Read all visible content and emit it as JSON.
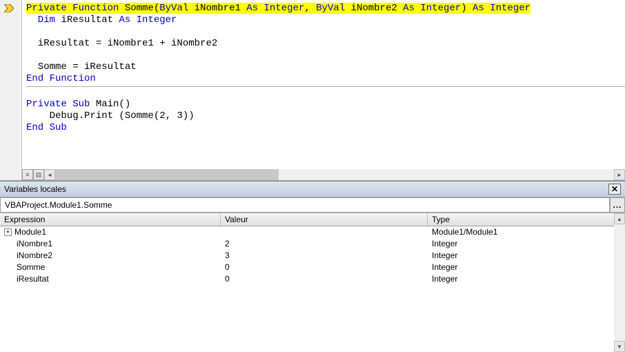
{
  "code": {
    "line1_highlighted": true,
    "l1a": "Private Function ",
    "l1b": "Somme(",
    "l1c": "ByVal ",
    "l1d": "iNombre1 ",
    "l1e": "As Integer",
    "l1f": ", ",
    "l1g": "ByVal ",
    "l1h": "iNombre2 ",
    "l1i": "As Integer",
    "l1j": ") ",
    "l1k": "As Integer",
    "l2a": "  Dim ",
    "l2b": "iResultat ",
    "l2c": "As Integer",
    "l4": "  iResultat = iNombre1 + iNombre2",
    "l6": "  Somme = iResultat",
    "l7": "End Function",
    "l9a": "Private Sub ",
    "l9b": "Main()",
    "l10": "    Debug.Print (Somme(2, 3))",
    "l11": "End Sub"
  },
  "locals": {
    "title": "Variables locales",
    "context": "VBAProject.Module1.Somme",
    "headers": {
      "expr": "Expression",
      "val": "Valeur",
      "type": "Type"
    },
    "rows": [
      {
        "expander": "+",
        "indent": 0,
        "expr": "Module1",
        "val": "",
        "type": "Module1/Module1"
      },
      {
        "expander": "",
        "indent": 1,
        "expr": "iNombre1",
        "val": "2",
        "type": "Integer"
      },
      {
        "expander": "",
        "indent": 1,
        "expr": "iNombre2",
        "val": "3",
        "type": "Integer"
      },
      {
        "expander": "",
        "indent": 1,
        "expr": "Somme",
        "val": "0",
        "type": "Integer"
      },
      {
        "expander": "",
        "indent": 1,
        "expr": "iResultat",
        "val": "0",
        "type": "Integer"
      }
    ]
  },
  "icons": {
    "close": "✕",
    "ellipsis": "...",
    "scroll_left": "◄",
    "scroll_right": "►",
    "scroll_up": "▲",
    "scroll_down": "▼"
  }
}
